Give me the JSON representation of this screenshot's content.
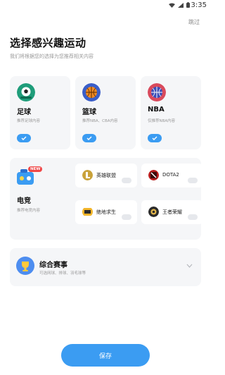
{
  "status_bar": {
    "time": "3:35"
  },
  "header": {
    "skip_label": "跳过",
    "title": "选择感兴趣运动",
    "subtitle": "我们将根据您的选择为您推荐相关内容"
  },
  "sports": [
    {
      "name": "足球",
      "desc": "推荐足球内容",
      "selected": true,
      "icon": "soccer-icon"
    },
    {
      "name": "篮球",
      "desc": "推荐NBA、CBA内容",
      "selected": true,
      "icon": "basketball-icon"
    },
    {
      "name": "NBA",
      "desc": "仅推荐NBA内容",
      "selected": true,
      "icon": "nba-icon"
    }
  ],
  "esports": {
    "badge": "NEW",
    "name": "电竞",
    "desc": "推荐电竞内容",
    "games": [
      {
        "label": "英雄联盟",
        "icon": "lol-icon",
        "selected": false
      },
      {
        "label": "DOTA2",
        "icon": "dota2-icon",
        "selected": false
      },
      {
        "label": "绝地求生",
        "icon": "pubg-icon",
        "selected": false
      },
      {
        "label": "王者荣耀",
        "icon": "hok-icon",
        "selected": false
      }
    ]
  },
  "combined": {
    "name": "综合赛事",
    "desc": "可选网球、排球、羽毛球等"
  },
  "footer": {
    "save_label": "保存"
  },
  "colors": {
    "accent": "#3b9cf2",
    "card_bg": "#f5f6f8"
  }
}
